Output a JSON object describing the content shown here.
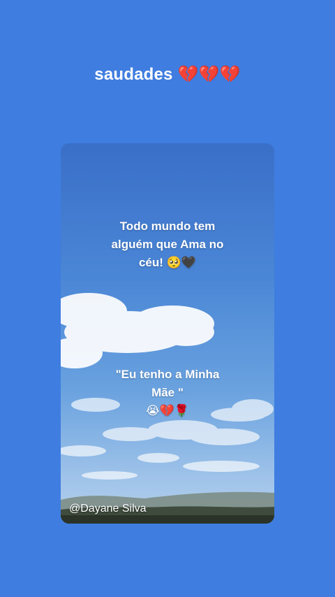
{
  "header": {
    "title": "saudades",
    "emoji": "💔💔💔"
  },
  "card": {
    "line1": "Todo mundo tem",
    "line2": "alguém que Ama no",
    "line3": "céu!",
    "line3_emoji": "🥺🖤",
    "line4": "\"Eu tenho a Minha",
    "line5": "Mãe \"",
    "line6_emoji": "😭💔🌹",
    "watermark": "@Dayane Silva"
  },
  "colors": {
    "background": "#3f7de0",
    "text": "#ffffff",
    "heart": "#d3213a"
  }
}
